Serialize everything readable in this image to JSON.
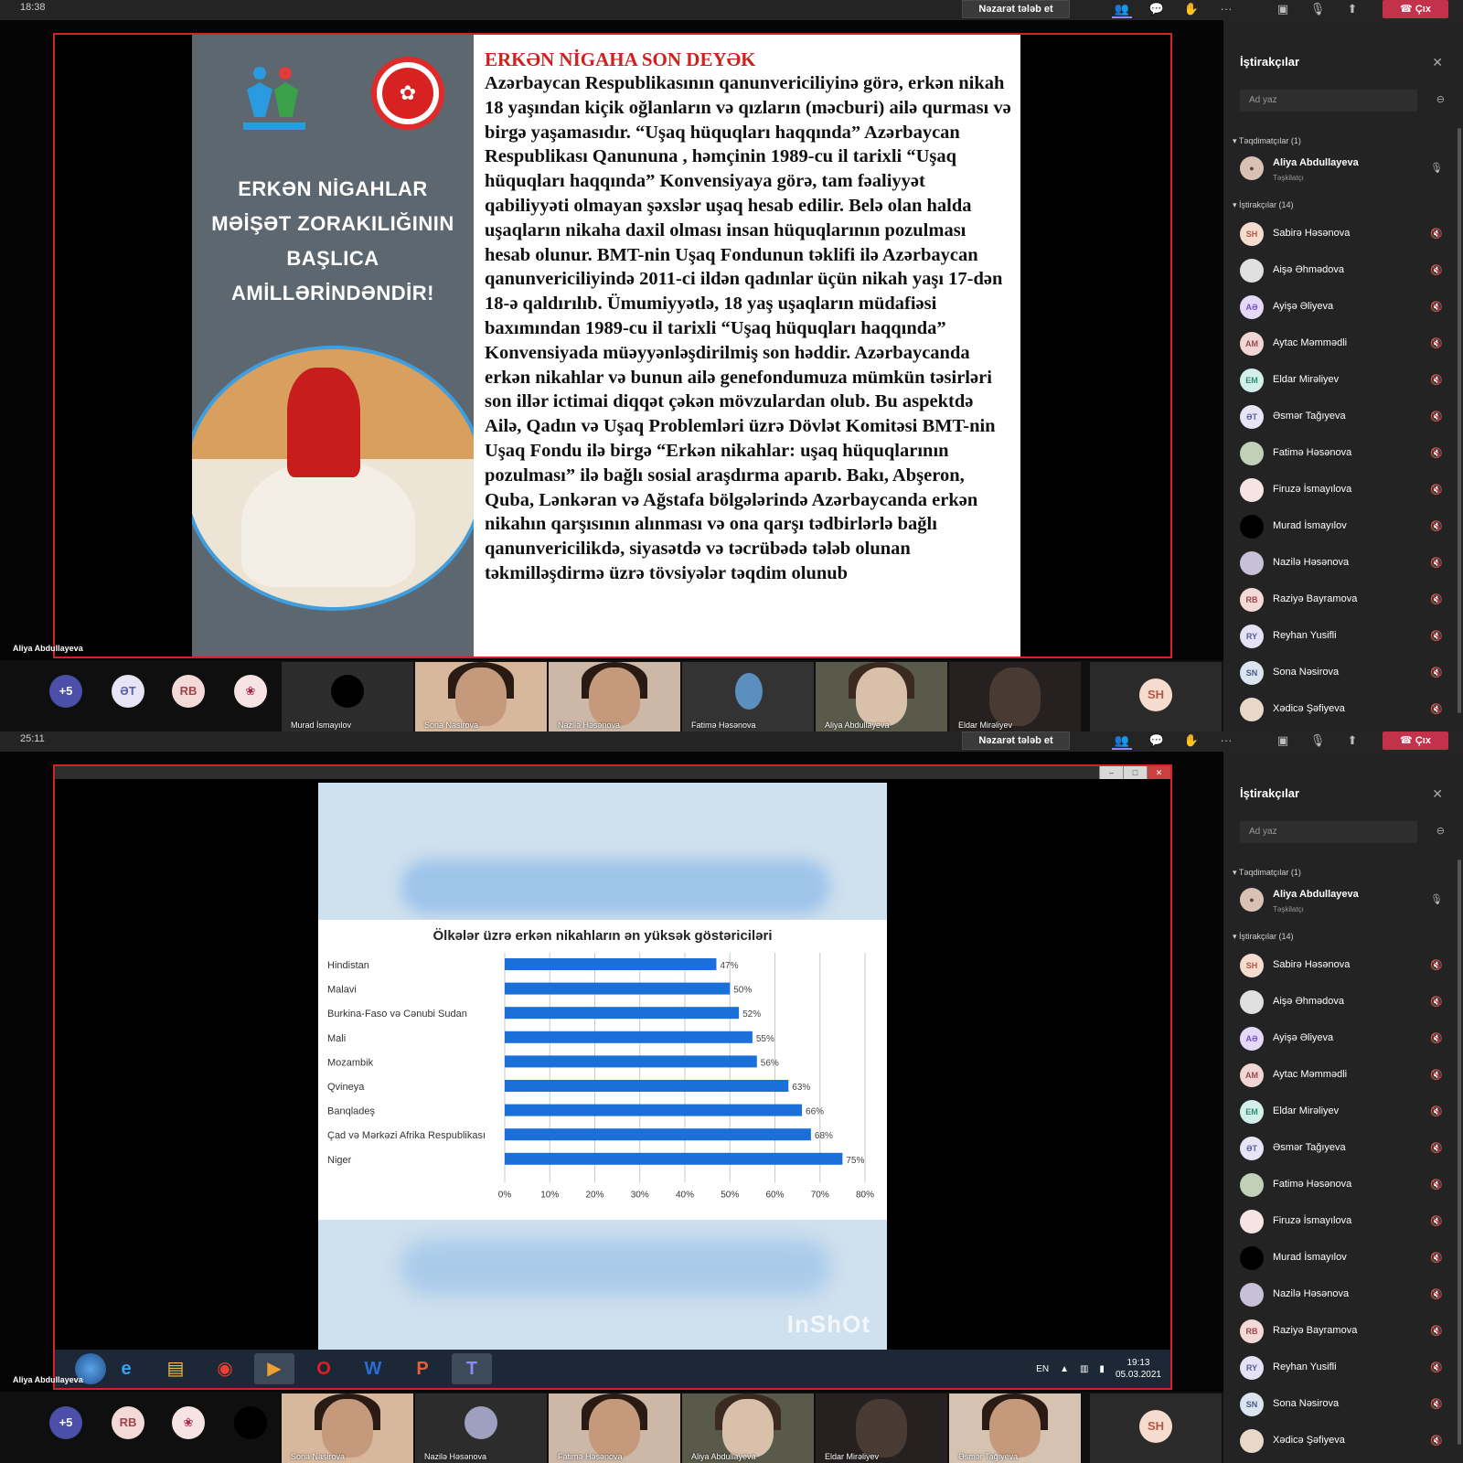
{
  "top": {
    "timer": "18:38",
    "request_control": "Nəzarət tələb et",
    "leave": "Çıx",
    "presenter_tag": "Aliya Abdullayeva",
    "slide": {
      "left_heading_lines": [
        "ERKƏN NİGAHLAR",
        "MƏİŞƏT ZORAKILIĞININ",
        "BAŞLICA",
        "AMİLLƏRİNDƏNDİR!"
      ],
      "title": "ERKƏN NİGAHA SON DEYƏK",
      "body": "Azərbaycan Respublikasının qanunvericiliyinə görə, erkən nikah 18 yaşından kiçik oğlanların və qızların (məcburi) ailə qurması və birgə yaşamasıdır. “Uşaq hüquqları haqqında” Azərbaycan Respublikası Qanununa , həmçinin 1989-cu il tarixli “Uşaq hüquqları haqqında” Konvensiyaya  görə, tam fəaliyyət qabiliyyəti olmayan şəxslər uşaq hesab edilir. Belə olan halda uşaqların nikaha daxil olması insan hüquqlarının pozulması hesab olunur. BMT-nin Uşaq Fondunun təklifi ilə Azərbaycan qanunvericiliyində 2011-ci ildən qadınlar üçün nikah yaşı 17-dən 18-ə qaldırılıb. Ümumiyyətlə, 18 yaş uşaqların müdafiəsi baxımından 1989-cu il tarixli “Uşaq hüquqları haqqında” Konvensiyada müəyyənləşdirilmiş son həddir. Azərbaycanda erkən nikahlar və bunun ailə genefondumuza mümkün təsirləri son illər ictimai diqqət çəkən mövzulardan olub. Bu aspektdə Ailə, Qadın və Uşaq Problemləri üzrə Dövlət Komitəsi BMT-nin Uşaq Fondu ilə birgə “Erkən nikahlar: uşaq hüquqlarının pozulması” ilə bağlı sosial araşdırma aparıb. Bakı, Abşeron, Quba, Lənkəran və Ağstafa bölgələrində Azərbaycanda erkən nikahın qarşısının alınması və ona qarşı tədbirlərlə bağlı qanunvericilikdə, siyasətdə və təcrübədə tələb olunan təkmilləşdirmə üzrə tövsiyələr təqdim olunub"
    },
    "strip": {
      "more": "+5",
      "avatars": [
        "ƏT",
        "RB"
      ],
      "tiles": [
        "Murad İsmayılov",
        "Sona Nasirova",
        "Nazilə Həsənova",
        "Fatimə Həsənova",
        "Aliya Abdullayeva",
        "Eldar Mirəliyev"
      ],
      "last_avatar": "SH"
    }
  },
  "bottom": {
    "timer": "25:11",
    "request_control": "Nəzarət tələb et",
    "leave": "Çıx",
    "presenter_tag": "Aliya Abdullayeva",
    "watermark": "InShOt",
    "tray": {
      "lang": "EN",
      "time": "19:13",
      "date": "05.03.2021"
    },
    "strip": {
      "more": "+5",
      "avatars": [
        "RB"
      ],
      "tiles": [
        "Sona Nasirova",
        "Nazilə Həsənova",
        "Fatimə Həsənova",
        "Aliya Abdullayeva",
        "Eldar Mirəliyev",
        "Əsmər Tağıyeva"
      ],
      "last_avatar": "SH"
    }
  },
  "sidebar": {
    "title": "İştirakçılar",
    "search_placeholder": "Ad yaz",
    "presenters_header": "Təqdimatçılar (1)",
    "presenter": {
      "name": "Aliya Abdullayeva",
      "role": "Təşkilatçı"
    },
    "attendees_header": "İştirakçılar (14)",
    "attendees": [
      {
        "initials": "SH",
        "name": "Sabirə Həsənova"
      },
      {
        "initials": "",
        "name": "Aişə Əhmədova"
      },
      {
        "initials": "AƏ",
        "name": "Ayişə Əliyeva"
      },
      {
        "initials": "AM",
        "name": "Aytac Məmmədli"
      },
      {
        "initials": "EM",
        "name": "Eldar Mirəliyev"
      },
      {
        "initials": "ƏT",
        "name": "Əsmər Tağıyeva"
      },
      {
        "initials": "",
        "name": "Fatimə Həsənova"
      },
      {
        "initials": "",
        "name": "Firuzə İsmayılova"
      },
      {
        "initials": "",
        "name": "Murad İsmayılov"
      },
      {
        "initials": "",
        "name": "Nazilə Həsənova"
      },
      {
        "initials": "RB",
        "name": "Raziyə Bayramova"
      },
      {
        "initials": "RY",
        "name": "Reyhan Yusifli"
      },
      {
        "initials": "SN",
        "name": "Sona Nəsirova"
      },
      {
        "initials": "",
        "name": "Xədicə Şəfiyeva"
      }
    ]
  },
  "colors": {
    "accent": "#8b8cf7",
    "leave": "#c4314b",
    "share_border": "#d32424",
    "bar": "#1a6fd8"
  },
  "chart_data": {
    "type": "bar",
    "orientation": "horizontal",
    "title": "Ölkələr üzrə erkən nikahların ən yüksək göstəriciləri",
    "categories": [
      "Hindistan",
      "Malavi",
      "Burkina-Faso və Cənubi Sudan",
      "Mali",
      "Mozambik",
      "Qvineya",
      "Banqladeş",
      "Çad və Mərkəzi Afrika Respublikası",
      "Niger"
    ],
    "values": [
      47,
      50,
      52,
      55,
      56,
      63,
      66,
      68,
      75
    ],
    "data_labels": [
      "47%",
      "50%",
      "52%",
      "55%",
      "56%",
      "63%",
      "66%",
      "68%",
      "75%"
    ],
    "xlim": [
      0,
      80
    ],
    "xticks": [
      "0%",
      "10%",
      "20%",
      "30%",
      "40%",
      "50%",
      "60%",
      "70%",
      "80%"
    ],
    "grid": true
  }
}
